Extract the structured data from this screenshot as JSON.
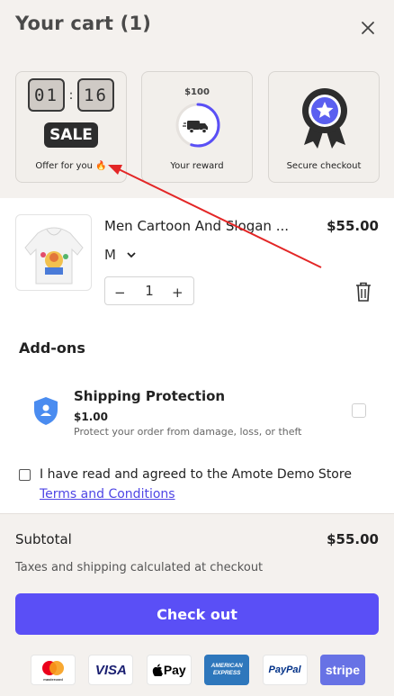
{
  "header": {
    "title": "Your cart (1)"
  },
  "perks": {
    "timer": {
      "minutes": "01",
      "separator": ":",
      "seconds": "16"
    },
    "sale_badge": "SALE",
    "offer_label": "Offer for you 🔥",
    "reward_price": "$100",
    "reward_label": "Your reward",
    "reward_progress": 0.55,
    "secure_label": "Secure checkout"
  },
  "item": {
    "name": "Men Cartoon And Slogan ...",
    "price": "$55.00",
    "variant": "M",
    "quantity": "1",
    "qty_minus": "−",
    "qty_plus": "+"
  },
  "addons": {
    "heading": "Add-ons",
    "shipping": {
      "title": "Shipping Protection",
      "price": "$1.00",
      "description": "Protect your order from damage, loss, or theft"
    }
  },
  "terms": {
    "text": "I have read and agreed to the Amote Demo Store ",
    "link": "Terms and Conditions"
  },
  "summary": {
    "subtotal_label": "Subtotal",
    "subtotal_value": "$55.00",
    "tax_note": "Taxes and shipping calculated at checkout",
    "checkout_label": "Check out"
  },
  "payments": {
    "visa": "VISA",
    "applepay": "Pay",
    "amex": "AMERICAN EXPRESS",
    "paypal": "PayPal",
    "stripe": "stripe",
    "mastercard": "mastercard"
  },
  "colors": {
    "accent": "#5a4ff6",
    "background": "#f4f1ee",
    "arrow": "#e32626",
    "shield": "#4a8cf0"
  }
}
